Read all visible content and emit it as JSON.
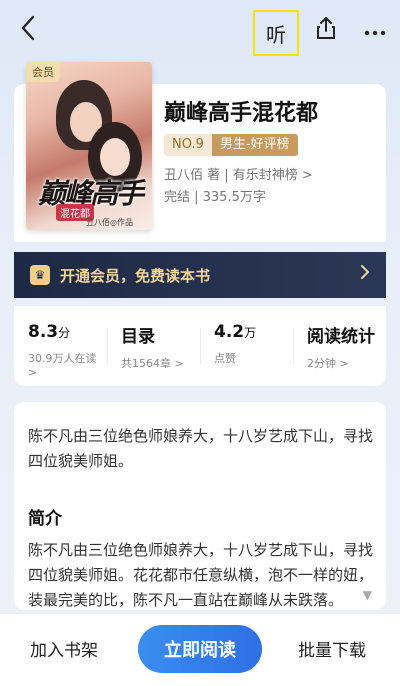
{
  "topbar": {
    "listen_label": "听",
    "back_icon": "chevron-left-icon",
    "share_icon": "share-icon",
    "more_icon": "more-dots-icon"
  },
  "book": {
    "cover_badge": "会员",
    "cover_title": "巅峰高手",
    "cover_subtitle": "混花都",
    "cover_author": "丑八佰◎作品",
    "title": "巅峰高手混花都",
    "rank_no": "NO.9",
    "rank_name": "男生-好评榜",
    "meta": "丑八佰 著 | 有乐封神榜 >",
    "status": "完结 | 335.5万字"
  },
  "vip_banner": {
    "text": "开通会员，免费读本书",
    "accent": "#f3d59a"
  },
  "stats": [
    {
      "value": "8.3",
      "unit": "分",
      "sub": "30.9万人在读 >"
    },
    {
      "value": "目录",
      "unit": "",
      "sub": "共1564章 >"
    },
    {
      "value": "4.2",
      "unit": "万",
      "sub": "点赞"
    },
    {
      "value": "阅读统计",
      "unit": "",
      "sub": "2分钟 >"
    }
  ],
  "description": {
    "tagline": "陈不凡由三位绝色师娘养大，十八岁艺成下山，寻找四位貌美师姐。",
    "intro_heading": "简介",
    "intro_body": "陈不凡由三位绝色师娘养大，十八岁艺成下山，寻找四位貌美师姐。花花都市任意纵横，泡不一样的妞，装最完美的比，陈不凡一直站在巅峰从未跌落。"
  },
  "bottom": {
    "add_shelf": "加入书架",
    "read_now": "立即阅读",
    "batch_download": "批量下载",
    "primary_color": "#2e6fe6"
  }
}
